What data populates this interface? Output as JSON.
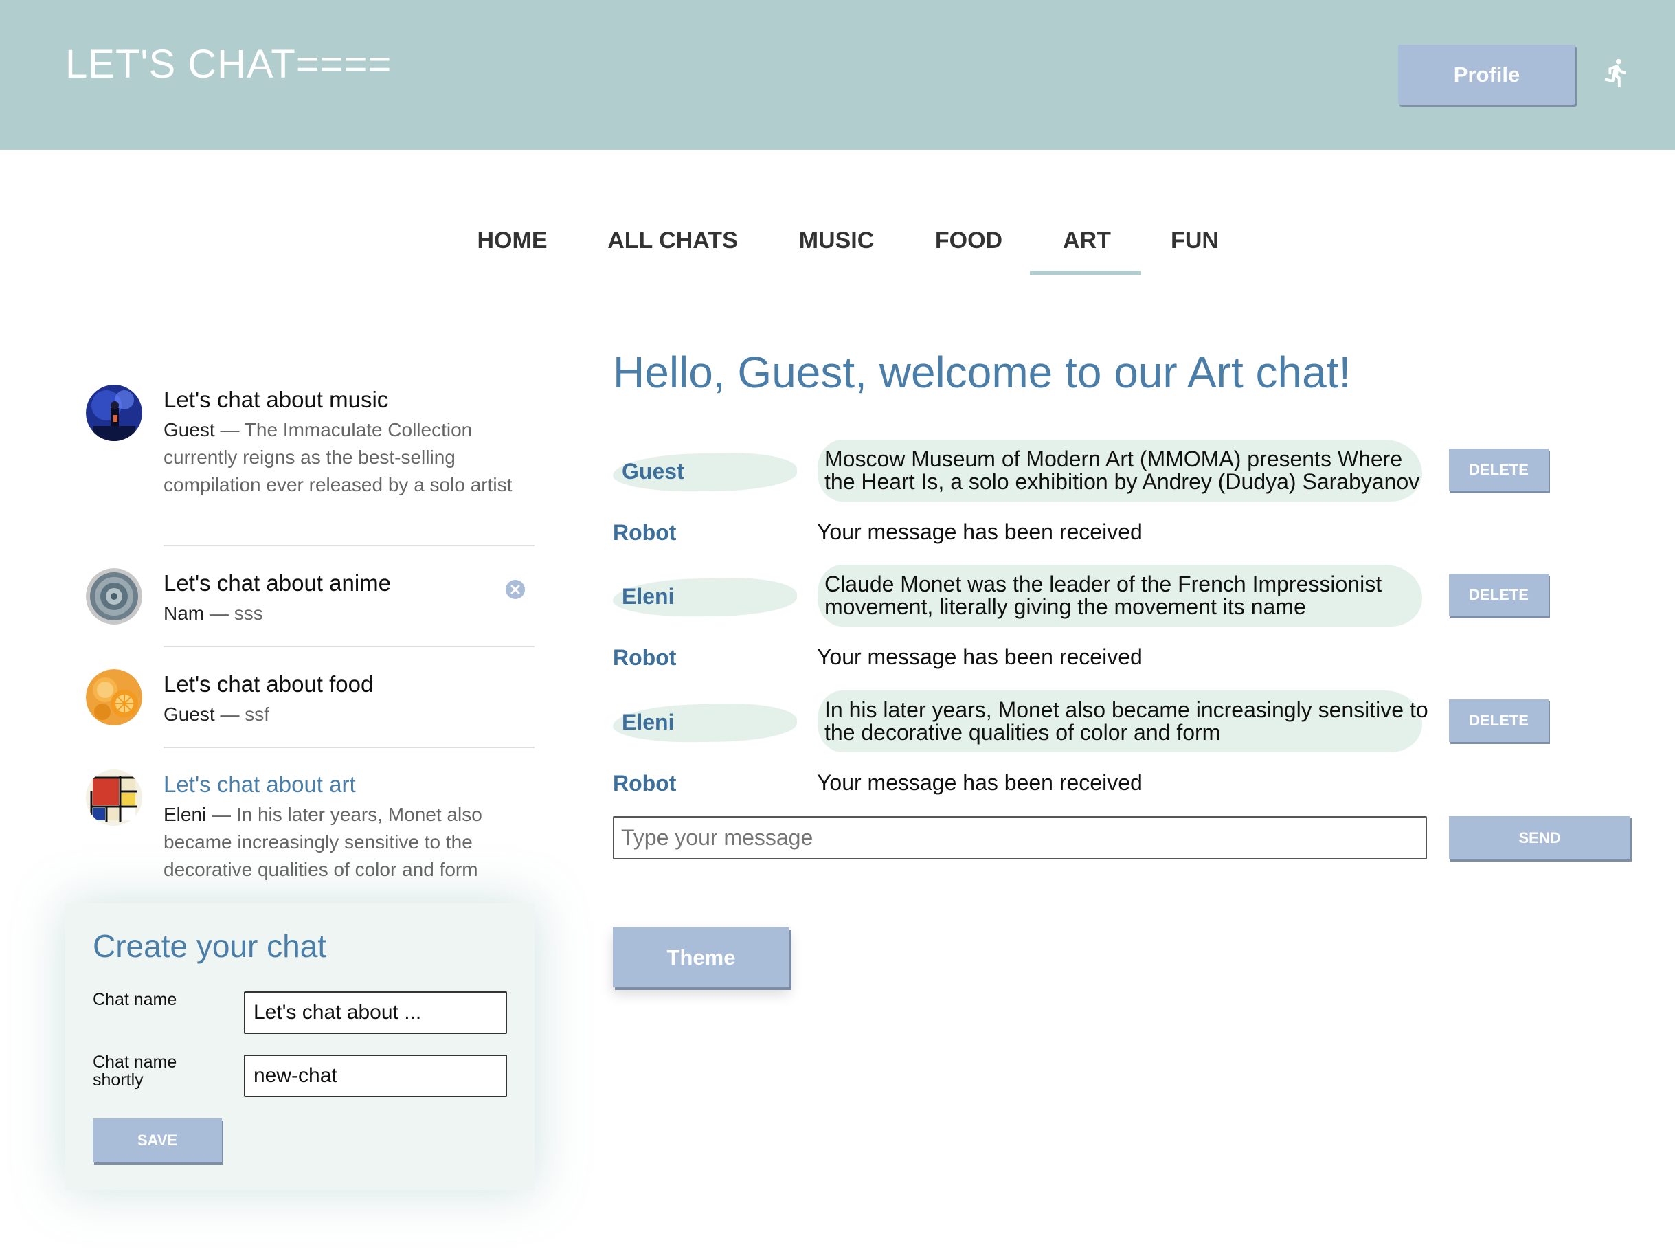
{
  "header": {
    "app_title": "LET'S CHAT====",
    "profile_label": "Profile",
    "exit_icon": "running-person-icon"
  },
  "nav": {
    "tabs": [
      {
        "label": "HOME",
        "active": false
      },
      {
        "label": "ALL CHATS",
        "active": false
      },
      {
        "label": "MUSIC",
        "active": false
      },
      {
        "label": "FOOD",
        "active": false
      },
      {
        "label": "ART",
        "active": true
      },
      {
        "label": "FUN",
        "active": false
      }
    ]
  },
  "sidebar": {
    "chats": [
      {
        "title": "Let's chat about music",
        "author": "Guest",
        "separator": " — ",
        "preview": "The Immaculate Collection currently reigns as the best-selling compilation ever released by a solo artist",
        "active": false
      },
      {
        "title": "Let's chat about anime",
        "author": "Nam",
        "separator": " — ",
        "preview": "sss",
        "active": false
      },
      {
        "title": "Let's chat about food",
        "author": "Guest",
        "separator": " — ",
        "preview": "ssf",
        "active": false
      },
      {
        "title": "Let's chat about art",
        "author": "Eleni",
        "separator": " — ",
        "preview": "In his later years, Monet also became increasingly sensitive to the decorative qualities of color and form",
        "active": true
      }
    ]
  },
  "create_chat": {
    "title": "Create your chat",
    "name_label": "Chat name",
    "name_value": "Let's chat about ...",
    "short_label": "Chat name shortly",
    "short_value": "new-chat",
    "save_label": "SAVE"
  },
  "main": {
    "welcome": "Hello, Guest, welcome to our Art chat!",
    "messages": [
      {
        "author": "Guest",
        "lines": [
          "Moscow Museum of Modern Art (MMOMA) presents Where",
          "the Heart Is, a solo exhibition by Andrey (Dudya) Sarabyanov"
        ],
        "deletable": true
      },
      {
        "author": "Robot",
        "lines": [
          "Your message has been received"
        ],
        "deletable": false
      },
      {
        "author": "Eleni",
        "lines": [
          "Claude Monet was the leader of the French Impressionist",
          "movement, literally giving the movement its name"
        ],
        "deletable": true
      },
      {
        "author": "Robot",
        "lines": [
          "Your message has been received"
        ],
        "deletable": false
      },
      {
        "author": "Eleni",
        "lines": [
          "In his later years, Monet also became increasingly sensitive to",
          "the decorative qualities of color and form"
        ],
        "deletable": true
      },
      {
        "author": "Robot",
        "lines": [
          "Your message has been received"
        ],
        "deletable": false
      }
    ],
    "delete_label": "DELETE",
    "input_placeholder": "Type your message",
    "send_label": "SEND",
    "theme_label": "Theme"
  }
}
